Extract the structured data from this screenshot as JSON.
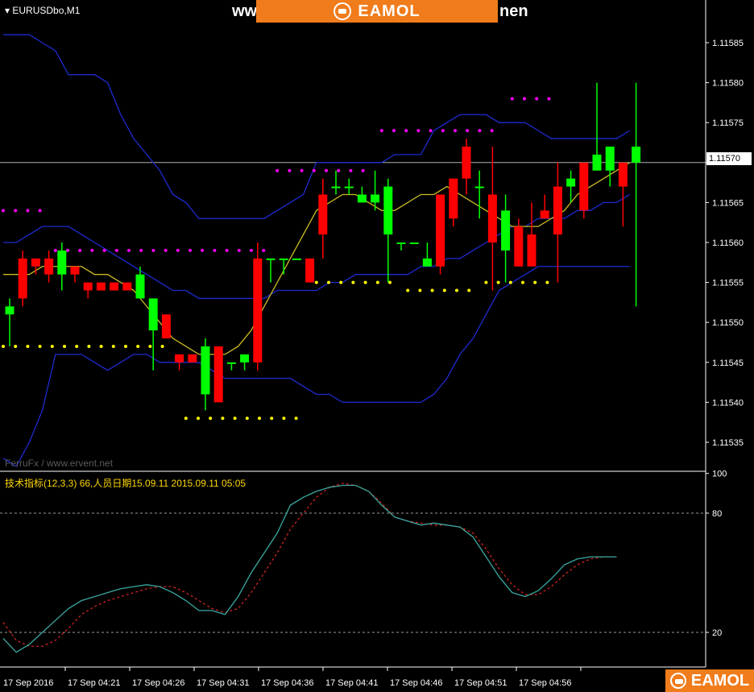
{
  "header": {
    "symbol": "EURUSDbo,M1",
    "banner_text": "EAMOL",
    "bg_text_left": "ww",
    "bg_text_right": "nen",
    "corner_logo_text": "EAMOL"
  },
  "watermark": "FerruFx / www.ervent.net",
  "indicator_label": "技术指标(12,3,3) 66,人员日期15.09.11 2015.09.11 05:05",
  "current_price_label": "1.11570",
  "colors": {
    "background": "#000000",
    "bull": "#00ff00",
    "bear": "#ff0000",
    "bollinger": "#1e2bd0",
    "ma": "#ccbb22",
    "resistance": "#ff00ff",
    "support": "#ffff00",
    "stoch_main": "#3aa8a0",
    "stoch_signal": "#cc2222",
    "grid_text": "#ffffff"
  },
  "chart_data": [
    {
      "type": "candlestick",
      "y_ticks": [
        "1.11585",
        "1.11580",
        "1.11575",
        "1.11570",
        "1.11565",
        "1.11560",
        "1.11555",
        "1.11550",
        "1.11545",
        "1.11540",
        "1.11535"
      ],
      "ylim": [
        1.1153,
        1.11589
      ],
      "x_ticks": [
        "17 Sep 2016",
        "17 Sep 04:21",
        "17 Sep 04:26",
        "17 Sep 04:31",
        "17 Sep 04:36",
        "17 Sep 04:41",
        "17 Sep 04:46",
        "17 Sep 04:51",
        "17 Sep 04:56"
      ],
      "current_price": 1.1157,
      "candles": [
        {
          "o": 1.11551,
          "h": 1.11553,
          "l": 1.11547,
          "c": 1.11552
        },
        {
          "o": 1.11558,
          "h": 1.11559,
          "l": 1.11552,
          "c": 1.11553
        },
        {
          "o": 1.11558,
          "h": 1.11558,
          "l": 1.11556,
          "c": 1.11557
        },
        {
          "o": 1.11558,
          "h": 1.11559,
          "l": 1.11555,
          "c": 1.11556
        },
        {
          "o": 1.11556,
          "h": 1.1156,
          "l": 1.11554,
          "c": 1.11559
        },
        {
          "o": 1.11557,
          "h": 1.11557,
          "l": 1.11555,
          "c": 1.11556
        },
        {
          "o": 1.11555,
          "h": 1.11555,
          "l": 1.11553,
          "c": 1.11554
        },
        {
          "o": 1.11555,
          "h": 1.11555,
          "l": 1.11554,
          "c": 1.11554
        },
        {
          "o": 1.11555,
          "h": 1.11555,
          "l": 1.11554,
          "c": 1.11554
        },
        {
          "o": 1.11555,
          "h": 1.11555,
          "l": 1.11554,
          "c": 1.11554
        },
        {
          "o": 1.11553,
          "h": 1.11557,
          "l": 1.11553,
          "c": 1.11556
        },
        {
          "o": 1.11549,
          "h": 1.11553,
          "l": 1.11544,
          "c": 1.11553
        },
        {
          "o": 1.11551,
          "h": 1.11551,
          "l": 1.11548,
          "c": 1.11548
        },
        {
          "o": 1.11546,
          "h": 1.11546,
          "l": 1.11544,
          "c": 1.11545
        },
        {
          "o": 1.11546,
          "h": 1.11546,
          "l": 1.11545,
          "c": 1.11545
        },
        {
          "o": 1.11541,
          "h": 1.11548,
          "l": 1.11539,
          "c": 1.11547
        },
        {
          "o": 1.11547,
          "h": 1.11547,
          "l": 1.1154,
          "c": 1.1154
        },
        {
          "o": 1.11545,
          "h": 1.11545,
          "l": 1.11544,
          "c": 1.11545
        },
        {
          "o": 1.11545,
          "h": 1.11546,
          "l": 1.11544,
          "c": 1.11546
        },
        {
          "o": 1.11558,
          "h": 1.1156,
          "l": 1.11544,
          "c": 1.11545
        },
        {
          "o": 1.11558,
          "h": 1.11558,
          "l": 1.11555,
          "c": 1.11558
        },
        {
          "o": 1.11558,
          "h": 1.11558,
          "l": 1.11556,
          "c": 1.11558
        },
        {
          "o": 1.11558,
          "h": 1.11558,
          "l": 1.11558,
          "c": 1.11558
        },
        {
          "o": 1.11558,
          "h": 1.11558,
          "l": 1.11555,
          "c": 1.11555
        },
        {
          "o": 1.11566,
          "h": 1.11568,
          "l": 1.11558,
          "c": 1.11561
        },
        {
          "o": 1.11567,
          "h": 1.11569,
          "l": 1.11566,
          "c": 1.11567
        },
        {
          "o": 1.11567,
          "h": 1.11568,
          "l": 1.11566,
          "c": 1.11567
        },
        {
          "o": 1.11565,
          "h": 1.11567,
          "l": 1.11565,
          "c": 1.11566
        },
        {
          "o": 1.11565,
          "h": 1.11569,
          "l": 1.11564,
          "c": 1.11566
        },
        {
          "o": 1.11561,
          "h": 1.11568,
          "l": 1.11555,
          "c": 1.11567
        },
        {
          "o": 1.1156,
          "h": 1.1156,
          "l": 1.11559,
          "c": 1.1156
        },
        {
          "o": 1.1156,
          "h": 1.1156,
          "l": 1.1156,
          "c": 1.1156
        },
        {
          "o": 1.11557,
          "h": 1.1156,
          "l": 1.11557,
          "c": 1.11558
        },
        {
          "o": 1.11566,
          "h": 1.11566,
          "l": 1.11556,
          "c": 1.11557
        },
        {
          "o": 1.11568,
          "h": 1.11568,
          "l": 1.11562,
          "c": 1.11563
        },
        {
          "o": 1.11572,
          "h": 1.11573,
          "l": 1.11566,
          "c": 1.11568
        },
        {
          "o": 1.11567,
          "h": 1.11569,
          "l": 1.11563,
          "c": 1.11567
        },
        {
          "o": 1.11566,
          "h": 1.11572,
          "l": 1.11554,
          "c": 1.1156
        },
        {
          "o": 1.11559,
          "h": 1.11566,
          "l": 1.11555,
          "c": 1.11564
        },
        {
          "o": 1.11562,
          "h": 1.11563,
          "l": 1.11557,
          "c": 1.11557
        },
        {
          "o": 1.11561,
          "h": 1.11565,
          "l": 1.11557,
          "c": 1.11557
        },
        {
          "o": 1.11564,
          "h": 1.11566,
          "l": 1.11563,
          "c": 1.11563
        },
        {
          "o": 1.11567,
          "h": 1.1157,
          "l": 1.11555,
          "c": 1.11561
        },
        {
          "o": 1.11567,
          "h": 1.11569,
          "l": 1.11565,
          "c": 1.11568
        },
        {
          "o": 1.1157,
          "h": 1.1157,
          "l": 1.11563,
          "c": 1.11564
        },
        {
          "o": 1.11569,
          "h": 1.1158,
          "l": 1.11569,
          "c": 1.11571
        },
        {
          "o": 1.11569,
          "h": 1.11572,
          "l": 1.11567,
          "c": 1.11572
        },
        {
          "o": 1.1157,
          "h": 1.1157,
          "l": 1.11562,
          "c": 1.11567
        },
        {
          "o": 1.1157,
          "h": 1.1158,
          "l": 1.11552,
          "c": 1.11572
        }
      ],
      "bollinger_upper": [
        1.11586,
        1.11586,
        1.11586,
        1.11585,
        1.11584,
        1.11581,
        1.11581,
        1.11581,
        1.1158,
        1.11576,
        1.11573,
        1.11571,
        1.11569,
        1.11566,
        1.11565,
        1.11563,
        1.11563,
        1.11563,
        1.11563,
        1.11563,
        1.11563,
        1.11564,
        1.11565,
        1.11566,
        1.1157,
        1.1157,
        1.1157,
        1.1157,
        1.1157,
        1.1157,
        1.11571,
        1.11571,
        1.11571,
        1.11574,
        1.11575,
        1.11576,
        1.11576,
        1.11576,
        1.11575,
        1.11575,
        1.11575,
        1.11574,
        1.11573,
        1.11573,
        1.11573,
        1.11573,
        1.11573,
        1.11573,
        1.11574
      ],
      "bollinger_middle": [
        1.1156,
        1.1156,
        1.11561,
        1.11562,
        1.11562,
        1.11562,
        1.11561,
        1.1156,
        1.11559,
        1.11558,
        1.11557,
        1.11556,
        1.11555,
        1.11554,
        1.11554,
        1.11553,
        1.11553,
        1.11553,
        1.11553,
        1.11553,
        1.11553,
        1.11554,
        1.11554,
        1.11554,
        1.11554,
        1.11555,
        1.11555,
        1.11556,
        1.11556,
        1.11556,
        1.11556,
        1.11556,
        1.11557,
        1.11557,
        1.11558,
        1.11558,
        1.11559,
        1.1156,
        1.11561,
        1.11562,
        1.11562,
        1.11563,
        1.11563,
        1.11563,
        1.11564,
        1.11564,
        1.11565,
        1.11565,
        1.11566
      ],
      "bollinger_lower": [
        1.11533,
        1.11532,
        1.11535,
        1.11539,
        1.11546,
        1.11546,
        1.11546,
        1.11545,
        1.11544,
        1.11545,
        1.11546,
        1.11546,
        1.11545,
        1.11545,
        1.11545,
        1.11545,
        1.11544,
        1.11543,
        1.11543,
        1.11543,
        1.11543,
        1.11543,
        1.11543,
        1.11542,
        1.11541,
        1.11541,
        1.1154,
        1.1154,
        1.1154,
        1.1154,
        1.1154,
        1.1154,
        1.1154,
        1.11541,
        1.11543,
        1.11546,
        1.11548,
        1.11551,
        1.11554,
        1.11555,
        1.11556,
        1.11557,
        1.11557,
        1.11557,
        1.11557,
        1.11557,
        1.11557,
        1.11557,
        1.11557
      ],
      "moving_average": [
        1.11556,
        1.11556,
        1.11556,
        1.11557,
        1.11557,
        1.11557,
        1.11557,
        1.11556,
        1.11556,
        1.11555,
        1.11554,
        1.11552,
        1.1155,
        1.11548,
        1.11547,
        1.11546,
        1.11546,
        1.11546,
        1.11547,
        1.11549,
        1.11552,
        1.11555,
        1.11558,
        1.11561,
        1.11564,
        1.11565,
        1.11566,
        1.11566,
        1.11565,
        1.11564,
        1.11564,
        1.11565,
        1.11566,
        1.11566,
        1.11567,
        1.11566,
        1.11565,
        1.11564,
        1.11563,
        1.11562,
        1.11562,
        1.11562,
        1.11563,
        1.11564,
        1.11566,
        1.11567,
        1.11568,
        1.11569,
        1.1157
      ],
      "resistance_levels": [
        {
          "price": 1.11564,
          "from": 0,
          "to": 3
        },
        {
          "price": 1.11559,
          "from": 4,
          "to": 20
        },
        {
          "price": 1.11569,
          "from": 21,
          "to": 28
        },
        {
          "price": 1.11574,
          "from": 29,
          "to": 38
        },
        {
          "price": 1.11578,
          "from": 39,
          "to": 42
        }
      ],
      "support_levels": [
        {
          "price": 1.11547,
          "from": 0,
          "to": 13
        },
        {
          "price": 1.11538,
          "from": 14,
          "to": 23
        },
        {
          "price": 1.11555,
          "from": 24,
          "to": 30
        },
        {
          "price": 1.11554,
          "from": 31,
          "to": 36
        },
        {
          "price": 1.11555,
          "from": 37,
          "to": 42
        }
      ]
    },
    {
      "type": "line",
      "y_ticks": [
        "100",
        "80",
        "20"
      ],
      "ylim": [
        0,
        100
      ],
      "levels": [
        80,
        20
      ],
      "series": [
        {
          "values": [
            17,
            10,
            14,
            20,
            26,
            32,
            36,
            38,
            40,
            42,
            43,
            44,
            43,
            40,
            36,
            31,
            31,
            29,
            38,
            50,
            60,
            70,
            84,
            88,
            91,
            93,
            94,
            94,
            91,
            84,
            78,
            76,
            74,
            75,
            74,
            73,
            68,
            58,
            48,
            40,
            38,
            41,
            47,
            54,
            57,
            58,
            58,
            58
          ]
        },
        {
          "values": [
            25,
            16,
            13,
            13,
            16,
            22,
            29,
            33,
            36,
            38,
            40,
            42,
            43,
            43,
            40,
            36,
            32,
            30,
            32,
            40,
            50,
            60,
            72,
            80,
            88,
            93,
            95,
            94,
            91,
            85,
            78,
            76,
            75,
            74,
            74,
            73,
            70,
            62,
            52,
            44,
            39,
            39,
            43,
            49,
            54,
            57,
            58,
            58
          ]
        }
      ]
    }
  ]
}
